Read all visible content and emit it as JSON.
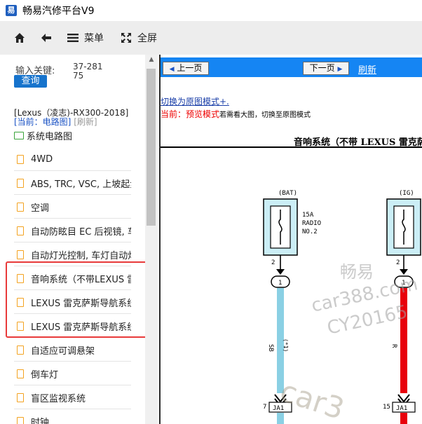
{
  "window": {
    "title": "畅易汽修平台V9"
  },
  "toolbar": {
    "home_icon": "home-icon",
    "back_icon": "back-arrow-icon",
    "menu_label": "菜单",
    "fullscreen_label": "全屏"
  },
  "sidebar": {
    "keyword_label": "输入关键:",
    "keyword_value": "37-28175",
    "search_label": "查询",
    "model": "[Lexus（凌志)-RX300-2018]",
    "current_prefix": "[当前：电路图]",
    "refresh_label": "[刷新]",
    "root_label": "系统电路图",
    "items": [
      "4WD",
      "ABS, TRC, VSC, 上坡起步辅助",
      "空调",
      "自动防眩目 EC 后视镜, 车库门开",
      "自动灯光控制, 车灯自动熄灭",
      "音响系统（不带LEXUS 雷克萨斯导航系统）",
      "LEXUS 雷克萨斯导航系统（不",
      "LEXUS 雷克萨斯导航系统（带",
      "自适应可调悬架",
      "倒车灯",
      "盲区监视系统",
      "时钟"
    ]
  },
  "viewer": {
    "prev_label": "上一页",
    "next_label": "下一页",
    "refresh_label": "刷新",
    "switch_link": "切换为原图模式+.",
    "current_mode_prefix": "当前：",
    "current_mode": "预览模式",
    "current_mode_hint": "若需看大图，切换至原图模式",
    "diagram_title": "音响系统（不带 LEXUS 雷克萨斯",
    "diagram": {
      "bat_label": "(BAT)",
      "ig_label": "(IG)",
      "fuse_label_1": "15A",
      "fuse_label_2": "RADIO",
      "fuse_label_3": "NO.2",
      "pin_left": "2",
      "pin_right": "2",
      "circle_left": "1",
      "circle_right": "1",
      "wire_left": "SB",
      "wire_left_extra": "(*1)",
      "wire_right": "R",
      "conn_left_pin": "7",
      "conn_left": "JA1",
      "conn_right_pin": "15",
      "conn_right": "JA1"
    },
    "watermark_1": "畅易",
    "watermark_2": "car388.com",
    "watermark_3": "CY20165",
    "watermark_4": "car3",
    "colors": {
      "wire_left": "#8ad0e4",
      "wire_right": "#e8000b",
      "nav_bar": "#1585f3",
      "highlight": "#e83a3a"
    }
  }
}
